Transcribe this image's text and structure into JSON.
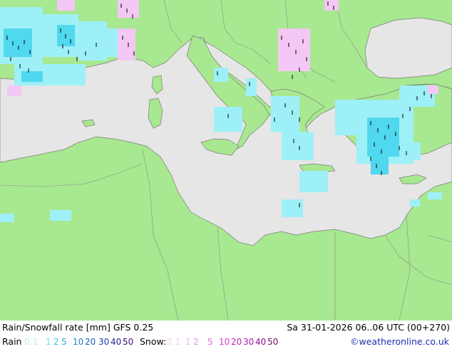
{
  "title": "Rain/Snowfall rate [mm] GFS 0.25",
  "datetime": "Sa 31-01-2026 06..06 UTC (00+270)",
  "legend": {
    "rain_label": "Rain",
    "snow_label": "Snow:",
    "rain_values": [
      {
        "text": "0.1",
        "color": "#bfeaf2"
      },
      {
        "text": "1",
        "color": "#79d8ea"
      },
      {
        "text": "2",
        "color": "#3bc3e0"
      },
      {
        "text": "5",
        "color": "#27a7d3"
      },
      {
        "text": "10",
        "color": "#2083c6"
      },
      {
        "text": "20",
        "color": "#1a62b5"
      },
      {
        "text": "30",
        "color": "#1a3ea0"
      },
      {
        "text": "40",
        "color": "#2a1e8c"
      },
      {
        "text": "50",
        "color": "#3a0f72"
      }
    ],
    "snow_values": [
      {
        "text": "0.1",
        "color": "#f4d4f0"
      },
      {
        "text": "1",
        "color": "#eeb2ea"
      },
      {
        "text": "2",
        "color": "#e88fe3"
      },
      {
        "text": "5",
        "color": "#e06ad8"
      },
      {
        "text": "10",
        "color": "#d43ec8"
      },
      {
        "text": "20",
        "color": "#c21eb3"
      },
      {
        "text": "30",
        "color": "#a8189c"
      },
      {
        "text": "40",
        "color": "#8e1282"
      },
      {
        "text": "50",
        "color": "#740e6a"
      }
    ]
  },
  "credit": "©weatheronline.co.uk",
  "colors": {
    "land": "#a8e890",
    "sea": "#e6e6e6",
    "border": "#8c8c8c",
    "rain_light": "#9ef0f8",
    "rain_mid": "#50d8ee",
    "snow_light": "#f4c8f4"
  }
}
